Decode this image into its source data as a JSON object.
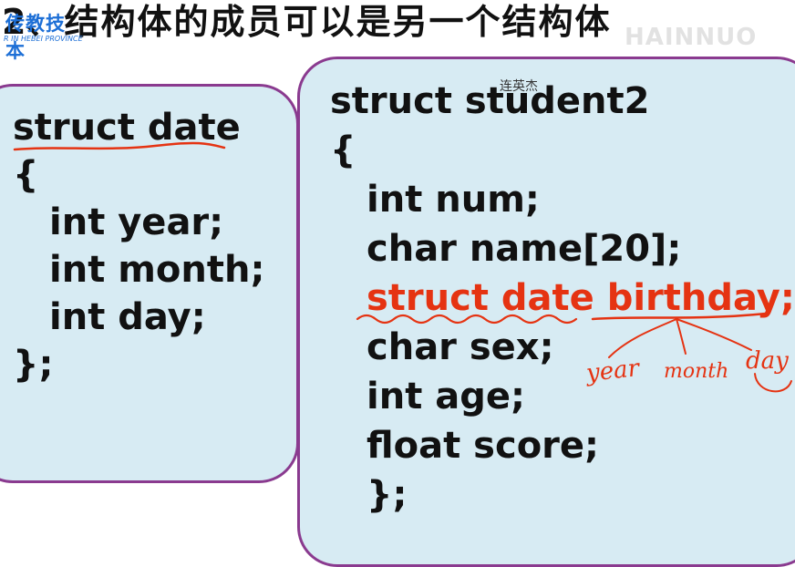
{
  "slide": {
    "title_number": "2、",
    "title_text": "结构体的成员可以是另一个结构体"
  },
  "logo": {
    "cn": "传教技本",
    "en": "R IN HEBEI PROVINCE"
  },
  "watermark": "HAINNUO",
  "caption": "连英杰",
  "left_code": [
    "struct date",
    "{",
    "int year;",
    "int month;",
    "int day;",
    "};"
  ],
  "right_code": [
    "struct student2",
    "{",
    "int num;",
    "char name[20];",
    "struct date birthday;",
    "char sex;",
    "int age;",
    "float score;",
    "};"
  ],
  "handwriting": {
    "labels": [
      "year",
      "month",
      "day"
    ],
    "color": "#e53312"
  },
  "colors": {
    "box_fill": "#d7ebf3",
    "box_border": "#8a3a8f",
    "highlight": "#e53312"
  }
}
